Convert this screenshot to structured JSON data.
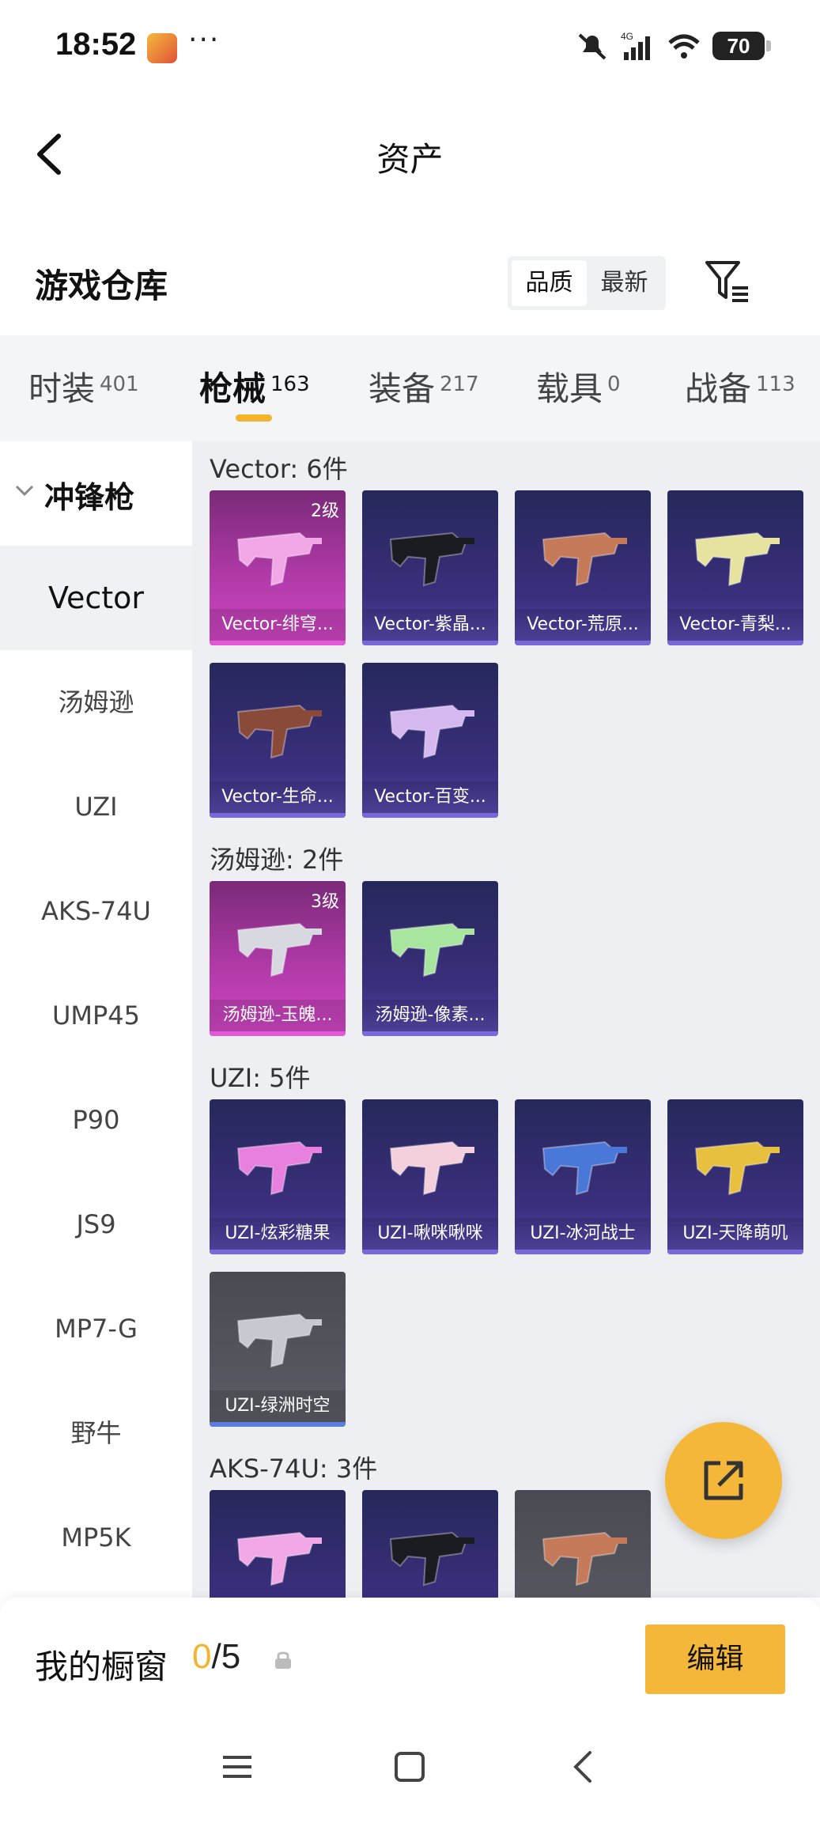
{
  "status_bar": {
    "time": "18:52",
    "more": "···",
    "network": "4G",
    "battery": "70"
  },
  "header": {
    "title": "资产"
  },
  "warehouse": {
    "title": "游戏仓库",
    "sort_options": [
      "品质",
      "最新"
    ]
  },
  "tabs": [
    {
      "label": "时装",
      "count": "401"
    },
    {
      "label": "枪械",
      "count": "163"
    },
    {
      "label": "装备",
      "count": "217"
    },
    {
      "label": "载具",
      "count": "0"
    },
    {
      "label": "战备",
      "count": "113"
    }
  ],
  "sidebar": {
    "category": "冲锋枪",
    "items": [
      "Vector",
      "汤姆逊",
      "UZI",
      "AKS-74U",
      "UMP45",
      "P90",
      "JS9",
      "MP7-G",
      "野牛",
      "MP5K"
    ]
  },
  "sections": [
    {
      "title": "Vector: 6件",
      "items": [
        {
          "name": "Vector-绯穹...",
          "level": "2级",
          "rarity": "pink"
        },
        {
          "name": "Vector-紫晶...",
          "rarity": "purple"
        },
        {
          "name": "Vector-荒原...",
          "rarity": "purple"
        },
        {
          "name": "Vector-青梨...",
          "rarity": "purple"
        },
        {
          "name": "Vector-生命...",
          "rarity": "purple"
        },
        {
          "name": "Vector-百变...",
          "rarity": "purple"
        }
      ]
    },
    {
      "title": "汤姆逊: 2件",
      "items": [
        {
          "name": "汤姆逊-玉魄...",
          "level": "3级",
          "rarity": "pink"
        },
        {
          "name": "汤姆逊-像素...",
          "rarity": "purple"
        }
      ]
    },
    {
      "title": "UZI: 5件",
      "items": [
        {
          "name": "UZI-炫彩糖果",
          "rarity": "purple"
        },
        {
          "name": "UZI-啾咪啾咪",
          "rarity": "purple"
        },
        {
          "name": "UZI-冰河战士",
          "rarity": "purple"
        },
        {
          "name": "UZI-天降萌叽",
          "rarity": "purple"
        },
        {
          "name": "UZI-绿洲时空",
          "rarity": "gray"
        }
      ]
    },
    {
      "title": "AKS-74U: 3件",
      "items": [
        {
          "name": "",
          "rarity": "purple"
        },
        {
          "name": "",
          "rarity": "purple"
        },
        {
          "name": "",
          "rarity": "gray"
        }
      ]
    }
  ],
  "showcase": {
    "label": "我的橱窗",
    "current": "0",
    "total": "/5",
    "edit_label": "编辑"
  },
  "colors": {
    "accent": "#f4b73a",
    "rarity_pink": "#b03aa8",
    "rarity_purple": "#3b2f7e",
    "rarity_gray": "#5c5c66"
  }
}
